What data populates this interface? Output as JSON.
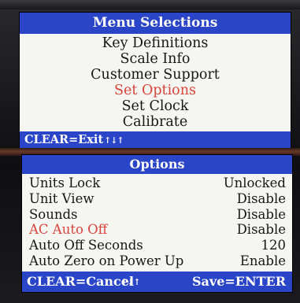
{
  "menu_screen": {
    "title": "Menu Selections",
    "items": [
      {
        "label": "Key Definitions"
      },
      {
        "label": "Scale Info"
      },
      {
        "label": "Customer Support"
      },
      {
        "label": "Set Options",
        "selected": true
      },
      {
        "label": "Set Clock"
      },
      {
        "label": "Calibrate"
      }
    ],
    "footer": {
      "left": "CLEAR=Exit",
      "arrows": "↑↓↑"
    }
  },
  "options_screen": {
    "title": "Options",
    "rows": [
      {
        "label": "Units Lock",
        "value": "Unlocked"
      },
      {
        "label": "Unit View",
        "value": "Disable"
      },
      {
        "label": "Sounds",
        "value": "Disable"
      },
      {
        "label": "AC Auto Off",
        "value": "Disable",
        "selected": true
      },
      {
        "label": "Auto Off Seconds",
        "value": "120"
      },
      {
        "label": "Auto Zero on Power Up",
        "value": "Enable"
      }
    ],
    "footer": {
      "left": "CLEAR=Cancel",
      "arrows": "↑↓↑",
      "right": "Save=ENTER"
    }
  },
  "colors": {
    "bar_blue": "#2a45c8",
    "highlight_red": "#d8443a",
    "screen_bg": "#f5f5f2",
    "text": "#161616"
  }
}
